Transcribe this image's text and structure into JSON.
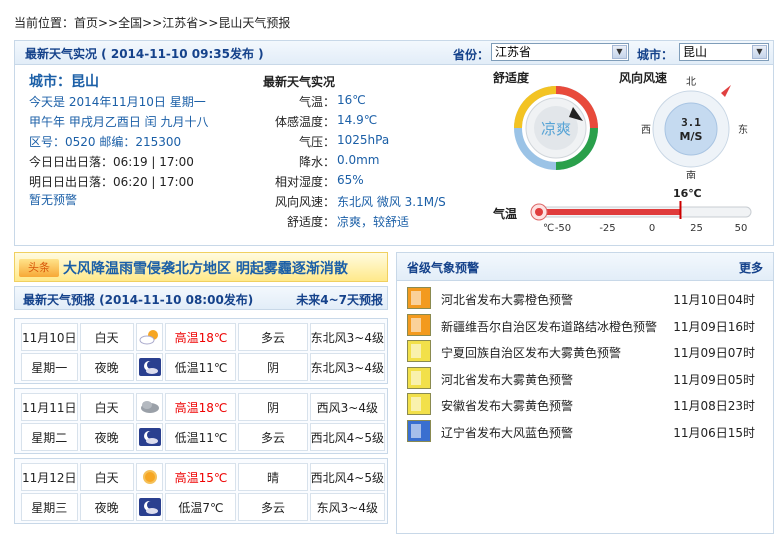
{
  "breadcrumb": {
    "prefix": "当前位置：",
    "home": "首页",
    "sep1": ">>",
    "country": "全国",
    "sep2": ">>",
    "province": "江苏省",
    "sep3": ">>",
    "current": "昆山天气预报"
  },
  "live": {
    "title": "最新天气实况 ( 2014-11-10  09:35发布 )",
    "province_label": "省份：",
    "province_value": "江苏省",
    "city_label": "城市：",
    "city_value": "昆山",
    "city_line": "城市：昆山",
    "today": "今天是 2014年11月10日 星期一",
    "lunar": "甲午年 甲戌月乙酉日 闰 九月十八",
    "codes": "区号：0520  邮编：215300",
    "sun_today": "今日日出日落：06:19 | 17:00",
    "sun_tomorrow": "明日日出日落：06:20 | 17:00",
    "warning": "暂无预警",
    "detail_title": "最新天气实况",
    "rows": [
      {
        "label": "气温：",
        "value": "16℃"
      },
      {
        "label": "体感温度：",
        "value": "14.9℃"
      },
      {
        "label": "气压：",
        "value": "1025hPa"
      },
      {
        "label": "降水：",
        "value": "0.0mm"
      },
      {
        "label": "相对湿度：",
        "value": "65%"
      },
      {
        "label": "风向风速：",
        "value": "东北风 微风 3.1M/S"
      },
      {
        "label": "舒适度：",
        "value": "凉爽，较舒适"
      }
    ],
    "comfort_title": "舒适度",
    "comfort_value": "凉爽",
    "wind_title": "风向风速",
    "wind_value": "3.1",
    "wind_unit": "M/S",
    "compass": {
      "n": "北",
      "s": "南",
      "e": "东",
      "w": "西"
    },
    "temp_label": "气温",
    "temp_value": "16℃",
    "temp_current": 16,
    "temp_ticks": [
      "-50",
      "-25",
      "0",
      "25",
      "50"
    ],
    "temp_unit": "℃"
  },
  "headline": {
    "tag": "头条",
    "text": "大风降温雨雪侵袭北方地区  明起雾霾逐渐消散"
  },
  "forecast": {
    "title": "最新天气预报 (2014-11-10  08:00发布)",
    "more": "未来4~7天预报",
    "days": [
      {
        "date": "11月10日",
        "weekday": "星期一",
        "day": {
          "period": "白天",
          "icon": "sun-cloud-icon",
          "temp": "高温18℃",
          "weather": "多云",
          "wind": "东北风3~4级"
        },
        "night": {
          "period": "夜晚",
          "icon": "night-cloud-icon",
          "temp": "低温11℃",
          "weather": "阴",
          "wind": "东北风3~4级"
        }
      },
      {
        "date": "11月11日",
        "weekday": "星期二",
        "day": {
          "period": "白天",
          "icon": "overcast-icon",
          "temp": "高温18℃",
          "weather": "阴",
          "wind": "西风3~4级"
        },
        "night": {
          "period": "夜晚",
          "icon": "moon-cloud-icon",
          "temp": "低温11℃",
          "weather": "多云",
          "wind": "西北风4~5级"
        }
      },
      {
        "date": "11月12日",
        "weekday": "星期三",
        "day": {
          "period": "白天",
          "icon": "sunny-icon",
          "temp": "高温15℃",
          "weather": "晴",
          "wind": "西北风4~5级"
        },
        "night": {
          "period": "夜晚",
          "icon": "moon-cloud-icon",
          "temp": "低温7℃",
          "weather": "多云",
          "wind": "东风3~4级"
        }
      }
    ]
  },
  "alerts": {
    "title": "省级气象预警",
    "more": "更多",
    "items": [
      {
        "text": "河北省发布大雾橙色预警",
        "date": "11月10日04时",
        "color": "#f39a1e",
        "icon": "fog-orange-icon"
      },
      {
        "text": "新疆维吾尔自治区发布道路结冰橙色预警",
        "date": "11月09日16时",
        "color": "#f39a1e",
        "icon": "road-ice-orange-icon"
      },
      {
        "text": "宁夏回族自治区发布大雾黄色预警",
        "date": "11月09日07时",
        "color": "#f2e04a",
        "icon": "fog-yellow-icon"
      },
      {
        "text": "河北省发布大雾黄色预警",
        "date": "11月09日05时",
        "color": "#f2e04a",
        "icon": "fog-yellow-icon"
      },
      {
        "text": "安徽省发布大雾黄色预警",
        "date": "11月08日23时",
        "color": "#f2e04a",
        "icon": "fog-yellow-icon"
      },
      {
        "text": "辽宁省发布大风蓝色预警",
        "date": "11月06日15时",
        "color": "#3a6fd0",
        "icon": "wind-blue-icon"
      }
    ]
  }
}
